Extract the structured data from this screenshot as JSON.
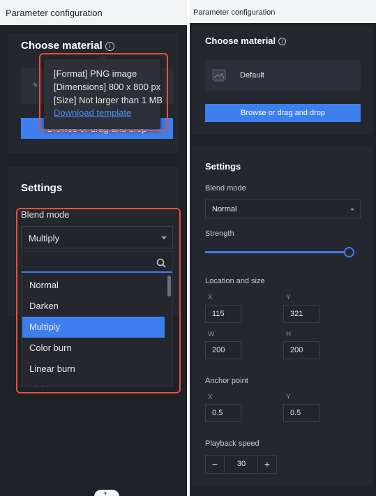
{
  "header": {
    "title": "Parameter configuration"
  },
  "material": {
    "title": "Choose material",
    "item_label": "Default",
    "upload_button": "Browse or drag and drop",
    "tooltip": {
      "format": "[Format] PNG image",
      "dimensions": "[Dimensions] 800 x 800 px",
      "size": "[Size] Not larger than 1 MB",
      "download_link": "Download template"
    }
  },
  "settings": {
    "title": "Settings",
    "blend_mode_label": "Blend mode",
    "blend_mode_value_left": "Multiply",
    "blend_mode_value_right": "Normal",
    "blend_options": [
      "Normal",
      "Darken",
      "Multiply",
      "Color burn",
      "Linear burn",
      "Lighten"
    ],
    "selected_option_index": 2,
    "strength_label": "Strength",
    "strength_level": 1.0,
    "location_size_label": "Location and size",
    "x_label": "X",
    "x_value": "115",
    "y_label": "Y",
    "y_value": "321",
    "w_label": "W",
    "w_value": "200",
    "h_label": "H",
    "h_value": "200",
    "anchor_label": "Anchor point",
    "anchor_x_label": "X",
    "anchor_x_value": "0.5",
    "anchor_y_label": "Y",
    "anchor_y_value": "0.5",
    "playback_label": "Playback speed",
    "playback_minus": "−",
    "playback_value": "30",
    "playback_plus": "+"
  },
  "icons": {
    "info": "info-icon",
    "search": "search-icon",
    "caret": "caret-down-icon",
    "image": "image-icon",
    "collapse": "chevron-down-icon"
  },
  "colors": {
    "accent": "#3e7ff0",
    "panel_bg": "#1e2127",
    "card_bg": "#24272e",
    "annotation": "#e8503a"
  }
}
